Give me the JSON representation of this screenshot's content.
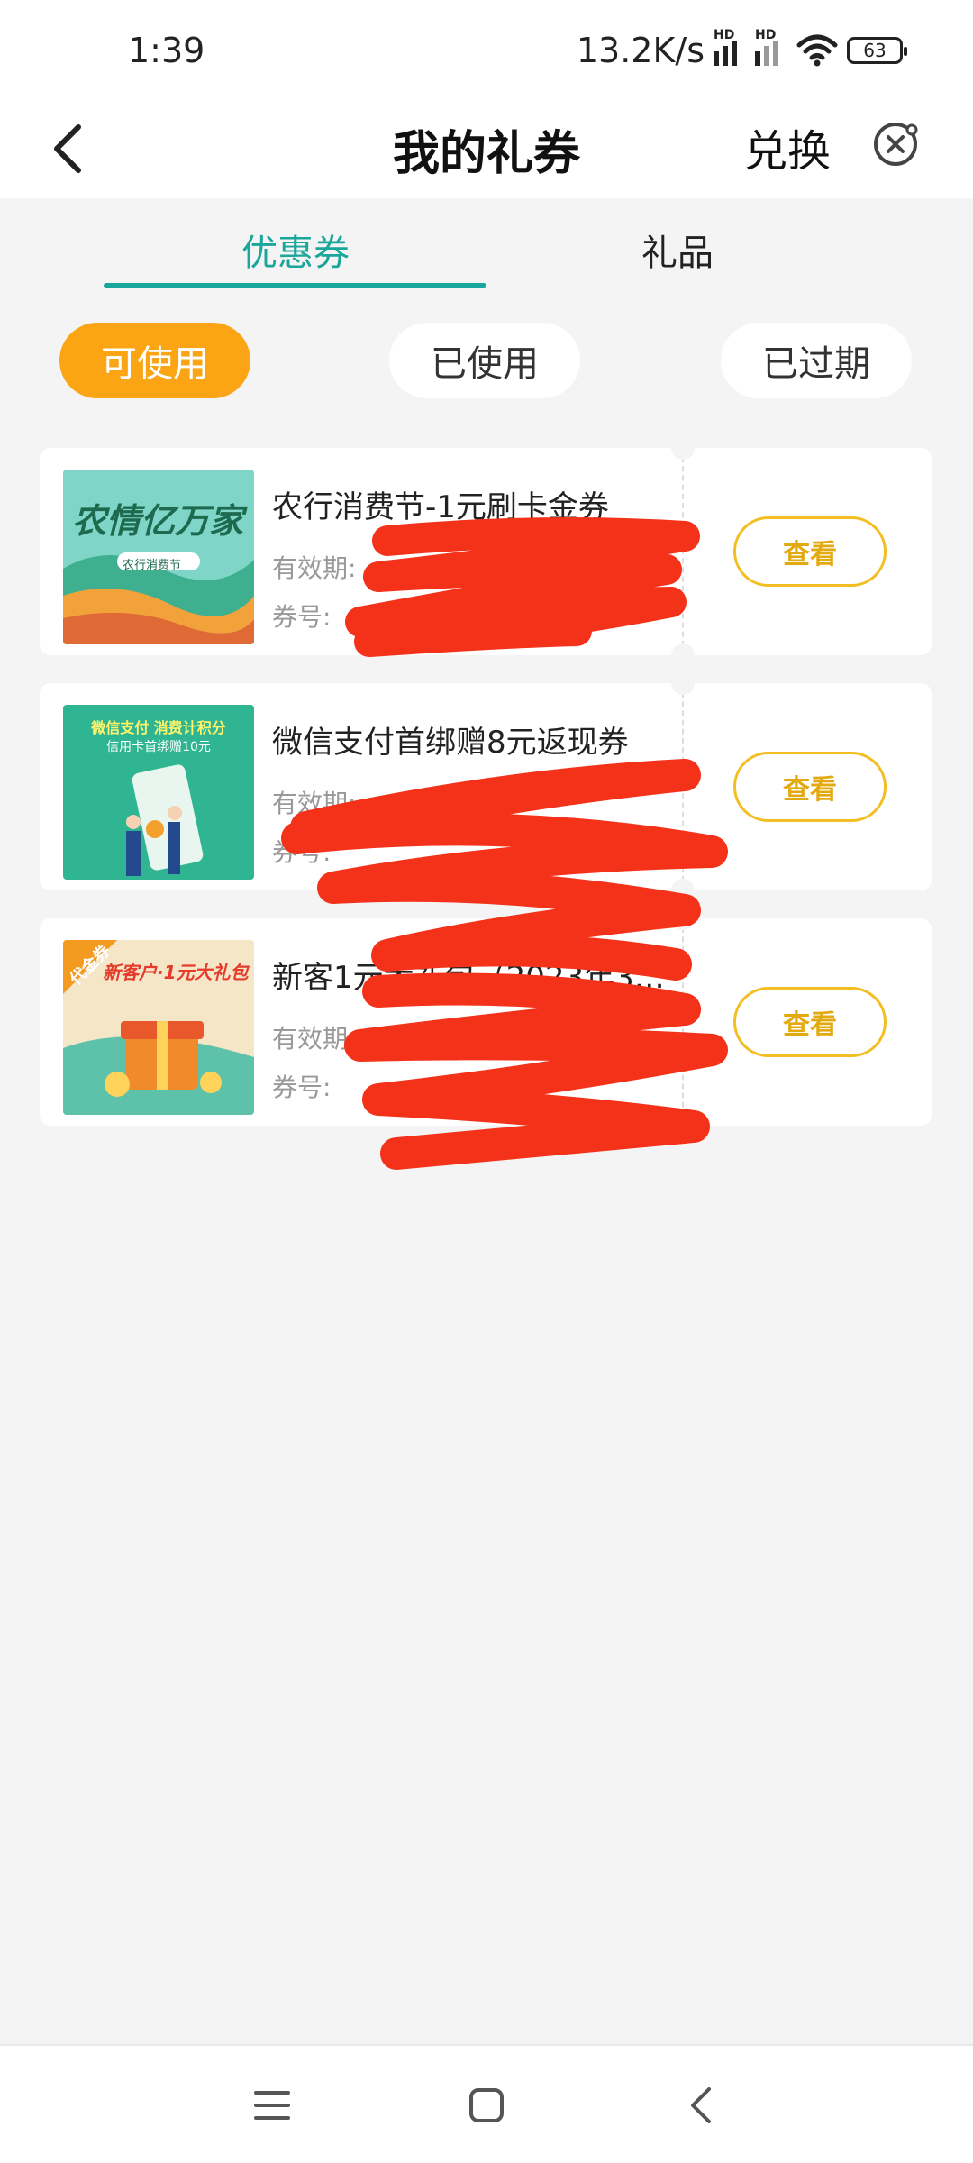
{
  "status_bar": {
    "time": "1:39",
    "net_speed": "13.2K/s",
    "hd_label": "HD",
    "battery": "63"
  },
  "header": {
    "title": "我的礼券",
    "action_label": "兑换"
  },
  "tabs": [
    {
      "label": "优惠券",
      "active": true
    },
    {
      "label": "礼品",
      "active": false
    }
  ],
  "filters": [
    {
      "label": "可使用",
      "active": true
    },
    {
      "label": "已使用",
      "active": false
    },
    {
      "label": "已过期",
      "active": false
    }
  ],
  "coupons": [
    {
      "title": "农行消费节-1元刷卡金券",
      "validity_label": "有效期:",
      "code_label": "券号:",
      "view_label": "查看",
      "thumb_text": "农情亿万家",
      "thumb_subtext": "农行消费节"
    },
    {
      "title": "微信支付首绑赠8元返现券",
      "validity_label": "有效期:",
      "code_label": "券号:",
      "view_label": "查看",
      "thumb_text": "微信支付 消费计积分",
      "thumb_subtext": "信用卡首绑赠10元"
    },
    {
      "title": "新客1元大礼包（2023年3…",
      "validity_label": "有效期:",
      "code_label": "券号:",
      "view_label": "查看",
      "thumb_text": "新客户·1元大礼包",
      "thumb_subtext": "代金券"
    }
  ],
  "colors": {
    "accent_teal": "#1aa69a",
    "accent_orange": "#fba414",
    "button_gold": "#f2be22",
    "redaction_red": "#f4321a"
  }
}
